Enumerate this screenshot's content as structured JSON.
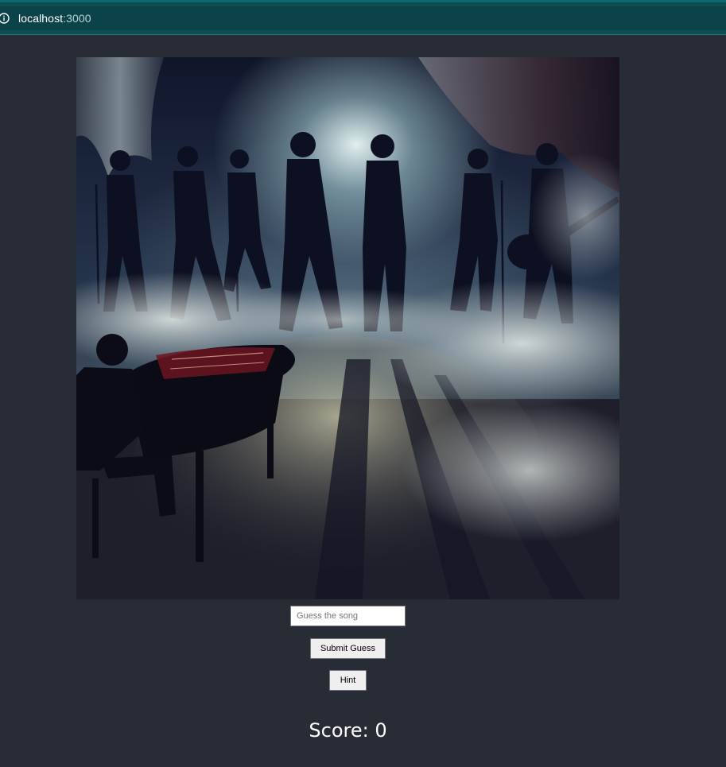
{
  "browser": {
    "url_host": "localhost",
    "url_port": ":3000",
    "info_icon": "info-icon"
  },
  "scene": {
    "description_icon": "band-scene-image"
  },
  "game": {
    "guess_placeholder": "Guess the song",
    "guess_value": "",
    "submit_label": "Submit Guess",
    "hint_label": "Hint",
    "score_text": "Score: 0"
  },
  "colors": {
    "page_background": "#282c34",
    "urlbar_background": "#0e4d52",
    "button_background": "#efefef"
  }
}
